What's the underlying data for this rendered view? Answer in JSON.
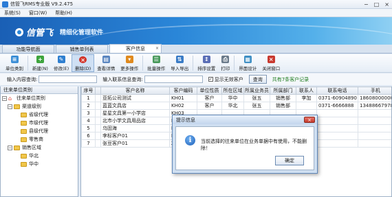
{
  "window": {
    "title": "信管飞RMS专业版  V9.2.475",
    "controls": [
      "−",
      "□",
      "×"
    ]
  },
  "menu": [
    "系统(S)",
    "窗口(W)",
    "帮助(H)"
  ],
  "banner": {
    "brand": "信管飞",
    "slogan": "精细化管理软件"
  },
  "tabs": [
    {
      "label": "功能导航面",
      "active": false
    },
    {
      "label": "销售单列表",
      "active": false
    },
    {
      "label": "客户信息",
      "active": true,
      "close": "×"
    }
  ],
  "toolbar": [
    {
      "label": "单位类别",
      "icon": "category-icon",
      "color": "#3d8fd6"
    },
    {
      "label": "新建(N)",
      "icon": "add-icon",
      "color": "#3ea53e"
    },
    {
      "label": "修改(E)",
      "icon": "edit-icon",
      "color": "#2e7fd0"
    },
    {
      "label": "删除(D)",
      "icon": "delete-icon",
      "color": "#d2342a"
    },
    {
      "label": "查看详情",
      "icon": "view-icon",
      "color": "#5a86c0"
    },
    {
      "label": "更多操作",
      "icon": "more-icon",
      "color": "#e08a1e"
    },
    {
      "label": "批量操作",
      "icon": "batch-icon",
      "color": "#4a9a5c"
    },
    {
      "label": "导入导出",
      "icon": "import-export-icon",
      "color": "#3a7cc6"
    },
    {
      "label": "排序设置",
      "icon": "sort-icon",
      "color": "#5b6fb6"
    },
    {
      "label": "打印",
      "icon": "print-icon",
      "color": "#6a7a8a"
    },
    {
      "label": "界面设计",
      "icon": "design-icon",
      "color": "#3f8fc4"
    },
    {
      "label": "关闭窗口",
      "icon": "close-window-icon",
      "color": "#c93a30"
    }
  ],
  "search": {
    "content_label": "输入内容查询:",
    "contact_label": "输入联系信息查询:",
    "show_invalid_label": "显示无效客户",
    "query_button": "查询",
    "count_text": "共有7条客户记录"
  },
  "tree": {
    "header": "往来单位类别",
    "nodes": [
      {
        "label": "往来单位类别",
        "level": 0,
        "type": "root"
      },
      {
        "label": "渠道级别",
        "level": 1,
        "type": "group"
      },
      {
        "label": "省级代理",
        "level": 2,
        "type": "leaf"
      },
      {
        "label": "市级代理",
        "level": 2,
        "type": "leaf"
      },
      {
        "label": "县级代理",
        "level": 2,
        "type": "leaf"
      },
      {
        "label": "零售商",
        "level": 2,
        "type": "leaf"
      },
      {
        "label": "销售区域",
        "level": 1,
        "type": "group"
      },
      {
        "label": "华北",
        "level": 2,
        "type": "leaf"
      },
      {
        "label": "华中",
        "level": 2,
        "type": "leaf"
      }
    ]
  },
  "table": {
    "columns": [
      "序号",
      "",
      "客户名称",
      "客户编码",
      "单位性质",
      "所在区域",
      "所属业务员",
      "所属部门",
      "联系人",
      "联系电话",
      "手机"
    ],
    "rows": [
      [
        "1",
        "",
        "亚拓公司测试",
        "KH01",
        "客户",
        "华中",
        "张五",
        "销售部",
        "李加",
        "0371-60904890",
        "18608000000"
      ],
      [
        "2",
        "",
        "蓝蓝文具店",
        "KH02",
        "客户",
        "华北",
        "张五",
        "销售部",
        "",
        "0371-6666888",
        "13488667978"
      ],
      [
        "3",
        "",
        "星星文具第一小学店",
        "KH03",
        "",
        "",
        "",
        "",
        "",
        "",
        ""
      ],
      [
        "4",
        "",
        "北市小学文具用品店",
        "KH04",
        "",
        "",
        "",
        "",
        "",
        "",
        ""
      ],
      [
        "5",
        "",
        "乌固海",
        "KH05",
        "",
        "",
        "",
        "",
        "",
        "",
        ""
      ],
      [
        "6",
        "",
        "李标客户01",
        "LTKH01",
        "",
        "",
        "",
        "",
        "",
        "",
        ""
      ],
      [
        "7",
        "",
        "张豆客户01",
        "ZDKH01",
        "",
        "",
        "",
        "",
        "",
        "",
        ""
      ]
    ]
  },
  "dialog": {
    "title": "提示信息",
    "close": "×",
    "message": "当前选择的往来单位在业务单据中有使用，不能删除！",
    "ok_button": "确定"
  }
}
